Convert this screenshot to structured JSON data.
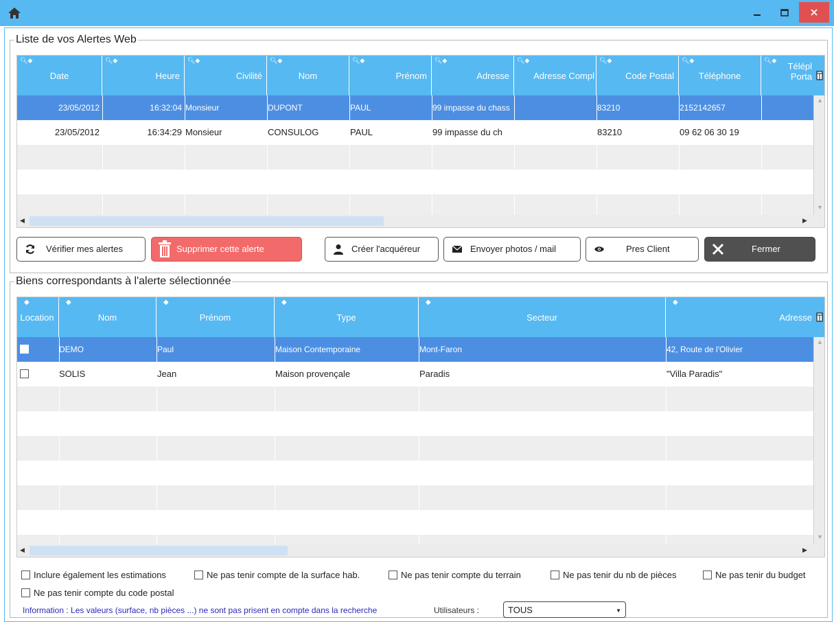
{
  "window": {
    "title_icon": "home-icon",
    "minimize_label": "–",
    "maximize_label": "☐",
    "close_label": "✕"
  },
  "alerts": {
    "title": "Liste de vos Alertes Web",
    "columns": [
      "Date",
      "Heure",
      "Civilité",
      "Nom",
      "Prénom",
      "Adresse",
      "Adresse Compl",
      "Code Postal",
      "Téléphone",
      "Téléphone Portable"
    ],
    "header_labels": {
      "date": "Date",
      "heure": "Heure",
      "civilite": "Civilité",
      "nom": "Nom",
      "prenom": "Prénom",
      "adresse": "Adresse",
      "adresse_compl": "Adresse Compl",
      "code_postal": "Code Postal",
      "telephone": "Téléphone",
      "tel_port_1": "Télépl",
      "tel_port_2": "Porta"
    },
    "rows": [
      {
        "date": "23/05/2012",
        "heure": "16:32:04",
        "civilite": "Monsieur",
        "nom": "DUPONT",
        "prenom": "PAUL",
        "adresse": "99 impasse du chass",
        "adresse_compl": "",
        "code_postal": "83210",
        "telephone": "2152142657",
        "portable": ""
      },
      {
        "date": "23/05/2012",
        "heure": "16:34:29",
        "civilite": "Monsieur",
        "nom": "CONSULOG",
        "prenom": "PAUL",
        "adresse": "99 impasse du ch",
        "adresse_compl": "",
        "code_postal": "83210",
        "telephone": "09 62 06 30 19",
        "portable": ""
      }
    ],
    "selected_row": 0
  },
  "buttons": {
    "verify": "Vérifier mes alertes",
    "delete": "Supprimer cette alerte",
    "create": "Créer l'acquéreur",
    "send": "Envoyer photos / mail",
    "pres": "Pres Client",
    "close": "Fermer"
  },
  "biens": {
    "title": "Biens correspondants à l'alerte sélectionnée",
    "header_labels": {
      "location": "Location",
      "nom": "Nom",
      "prenom": "Prénom",
      "type": "Type",
      "secteur": "Secteur",
      "adresse": "Adresse"
    },
    "rows": [
      {
        "location": false,
        "nom": "DEMO",
        "prenom": "Paul",
        "type": "Maison Contemporaine",
        "secteur": "Mont-Faron",
        "adresse": "42, Route de l'Olivier"
      },
      {
        "location": false,
        "nom": "SOLIS",
        "prenom": "Jean",
        "type": "Maison provençale",
        "secteur": "Paradis",
        "adresse": "\"Villa Paradis\""
      }
    ],
    "selected_row": 0
  },
  "options": {
    "include_estimations": "Inclure également les estimations",
    "ignore_surface": "Ne pas tenir compte de la surface hab.",
    "ignore_terrain": "Ne pas tenir compte du terrain",
    "ignore_pieces": "Ne pas tenir du nb de pièces",
    "ignore_budget": "Ne pas tenir du budget",
    "ignore_cp": "Ne pas tenir compte du code postal"
  },
  "footer": {
    "info": "Information : Les valeurs (surface, nb pièces ...) ne sont pas prisent en compte dans la recherche",
    "users_label": "Utilisateurs :",
    "users_value": "TOUS"
  },
  "colors": {
    "accent": "#56b9f2",
    "selected_row": "#4c8fe2",
    "delete_button": "#f26a6a",
    "close_button": "#505050",
    "info_text": "#2a2ab8"
  }
}
